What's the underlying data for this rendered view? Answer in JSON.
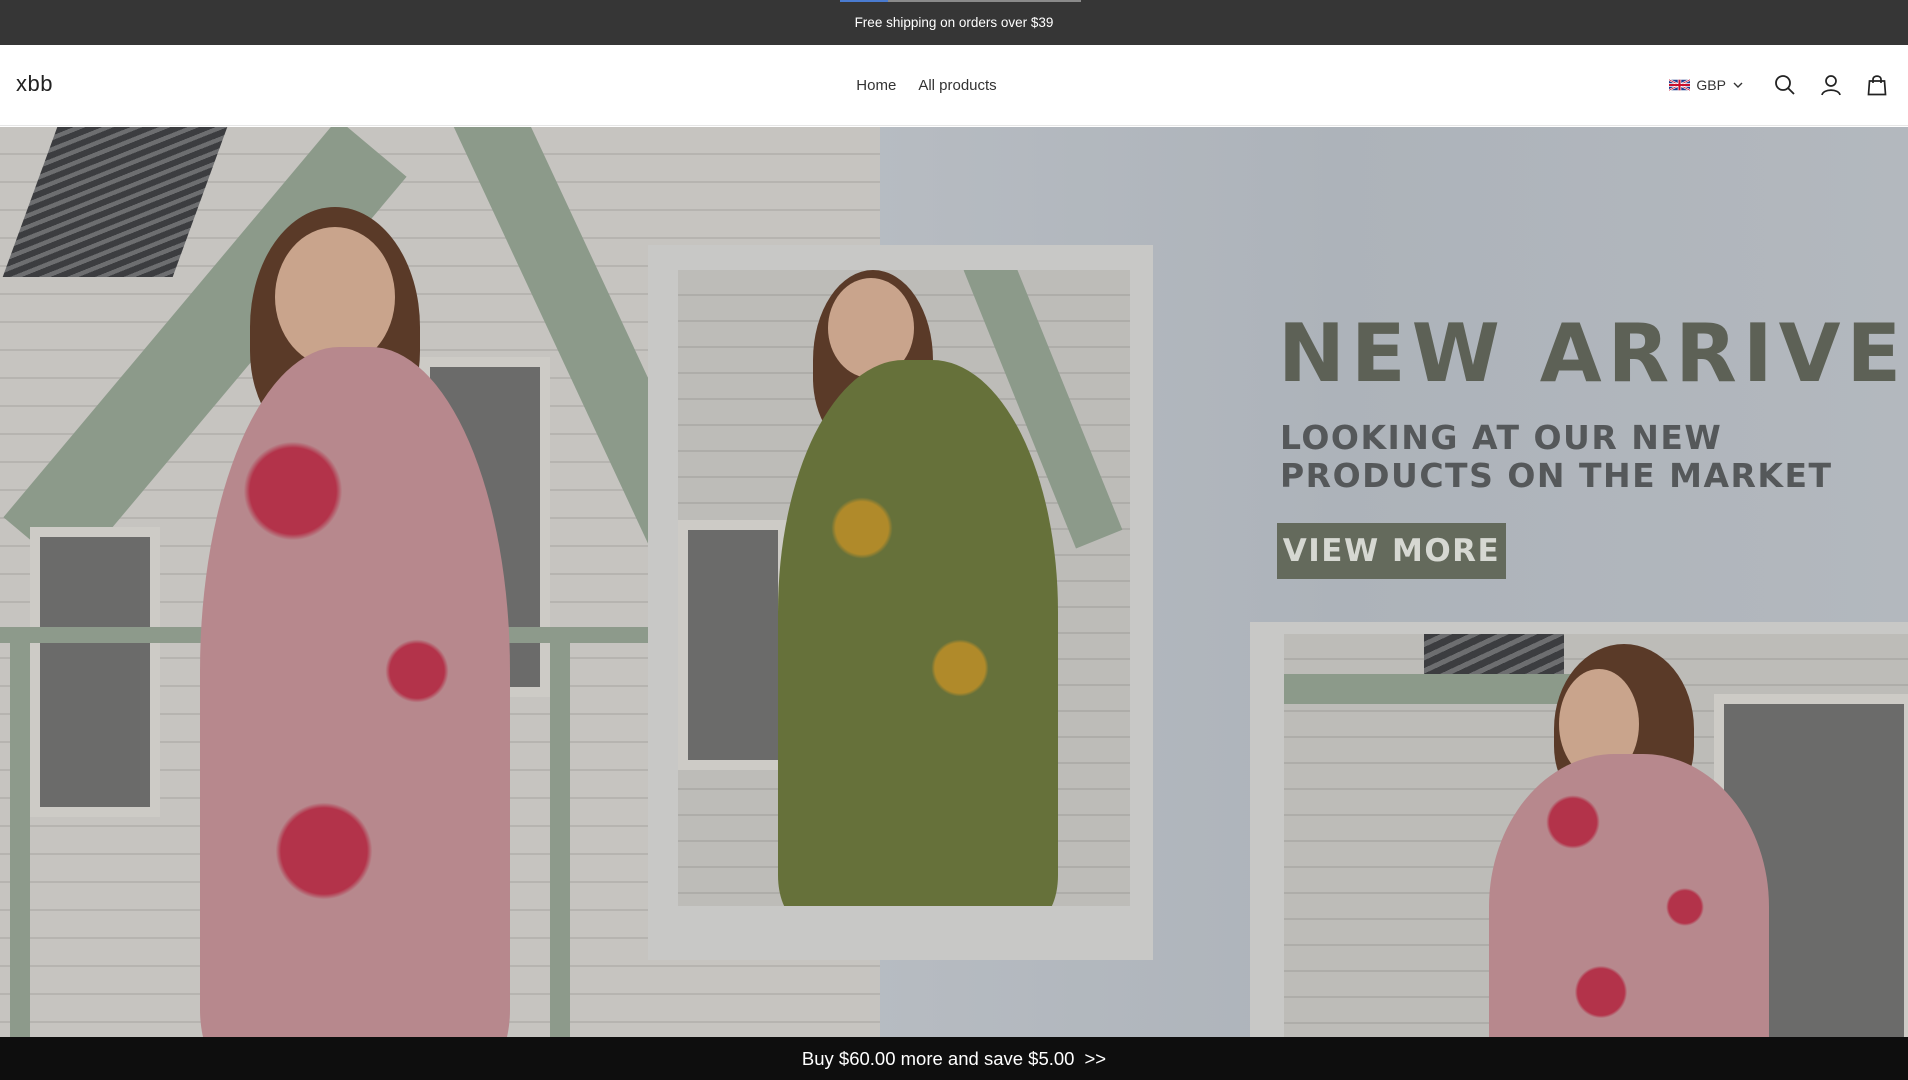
{
  "announcement": {
    "text": "Free shipping on orders over $39",
    "progress_fraction": 0.2
  },
  "header": {
    "logo": "xbb",
    "nav": [
      {
        "label": "Home"
      },
      {
        "label": "All products"
      }
    ],
    "currency": {
      "code": "GBP",
      "flag_icon": "uk-flag-icon"
    },
    "icons": [
      "search-icon",
      "account-icon",
      "cart-icon"
    ]
  },
  "hero": {
    "headline": "NEW ARRIVEL",
    "subline": "LOOKING AT OUR NEW PRODUCTS ON THE MARKET",
    "cta_label": "VIEW MORE"
  },
  "promo_bar": {
    "text": "Buy $60.00 more and save $5.00",
    "arrow": ">>"
  },
  "colors": {
    "announcement_bg": "#363636",
    "promo_bg": "#0e0e0e",
    "cta_bg": "#646a5c",
    "headline": "#5d6156"
  }
}
